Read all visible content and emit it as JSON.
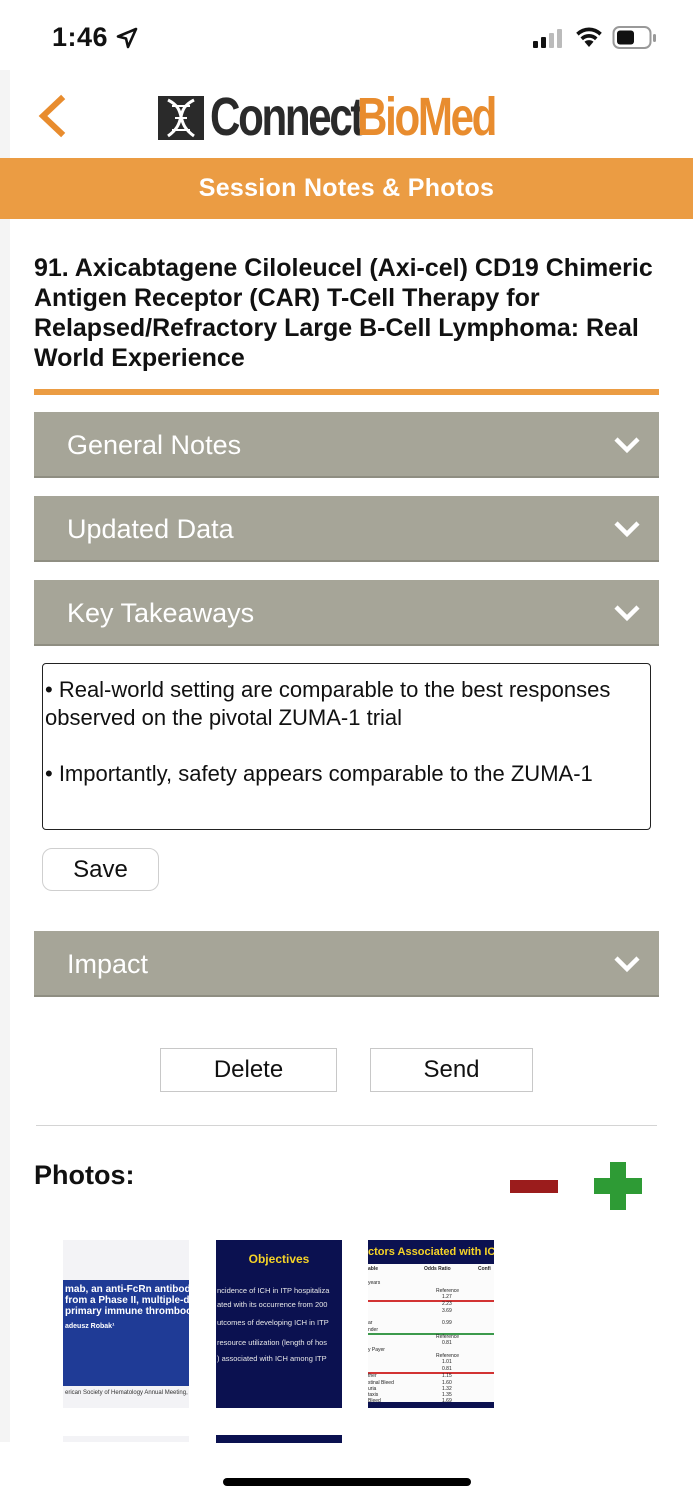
{
  "status_bar": {
    "time": "1:46"
  },
  "header": {
    "logo_part1": "Connect",
    "logo_part2": "BioMed",
    "banner": "Session Notes & Photos"
  },
  "session": {
    "title": "91. Axicabtagene Ciloleucel (Axi-cel) CD19 Chimeric Antigen Receptor (CAR) T-Cell Therapy for Relapsed/Refractory Large B-Cell Lymphoma: Real World Experience"
  },
  "sections": {
    "general_notes": "General Notes",
    "updated_data": "Updated Data",
    "key_takeaways": "Key Takeaways",
    "impact": "Impact"
  },
  "key_takeaways_text": {
    "bullet1": "• Real-world setting are comparable to the best responses observed on the pivotal ZUMA-1 trial",
    "bullet2": "• Importantly, safety appears comparable to the ZUMA-1"
  },
  "buttons": {
    "save": "Save",
    "delete": "Delete",
    "send": "Send"
  },
  "photos": {
    "label": "Photos:",
    "thumb1": {
      "line1": "mab, an anti-FcRn antibody",
      "line2": "from a Phase II, multiple-do",
      "line3": "primary immune thrombocy",
      "author": "adeusz Robak¹",
      "footer": "erican Society of Hematology Annual Meeting,"
    },
    "thumb2": {
      "heading": "Objectives",
      "line1": "ncidence of ICH in ITP hospitaliza",
      "line2": "ated with its occurrence from 200",
      "line3": "utcomes of developing ICH in ITP",
      "line4": "resource utilization (length of hos",
      "line5": ") associated with ICH among ITP"
    },
    "thumb3": {
      "heading": "ctors Associated with IC",
      "col1": "able",
      "col2": "Odds Ratio",
      "col3": "Confi",
      "rows": [
        "Reference",
        "1.27",
        "2.23",
        "3.69",
        "0.99",
        "Reference",
        "0.81",
        "Reference",
        "1.01",
        "0.81",
        "1.15",
        "1.60",
        "1.32",
        "1.35",
        "1.69"
      ],
      "labels": [
        "years",
        "ar",
        "nder",
        "y Payer",
        "ther",
        "stinal Bleed",
        "uria",
        "taxis",
        "Bleed"
      ]
    }
  }
}
